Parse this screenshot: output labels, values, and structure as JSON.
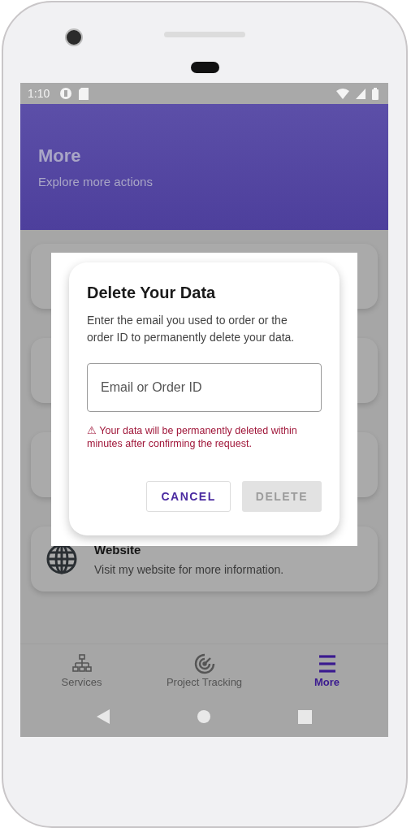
{
  "status_bar": {
    "time": "1:10"
  },
  "header": {
    "title": "More",
    "subtitle": "Explore more actions"
  },
  "cards": [
    {
      "kind": "hidden"
    },
    {
      "kind": "hidden"
    },
    {
      "kind": "hidden"
    },
    {
      "kind": "link",
      "title": "Website",
      "description": "Visit my website for more information."
    }
  ],
  "dialog": {
    "title": "Delete Your Data",
    "message": "Enter the email you used to order or the order ID to permanently delete your data.",
    "field": {
      "placeholder": "Email or Order ID"
    },
    "warning": "⚠ Your data will be permanently deleted within minutes after confirming the request.",
    "buttons": [
      {
        "label": "CANCEL",
        "kind": "outlined",
        "disabled": false
      },
      {
        "label": "DELETE",
        "kind": "filled",
        "disabled": true
      }
    ]
  },
  "bottom_nav": [
    {
      "label": "Services",
      "kind": "services",
      "selected": false
    },
    {
      "label": "Project Tracking",
      "kind": "tracking",
      "selected": false
    },
    {
      "label": "More",
      "kind": "menu",
      "selected": true
    }
  ]
}
